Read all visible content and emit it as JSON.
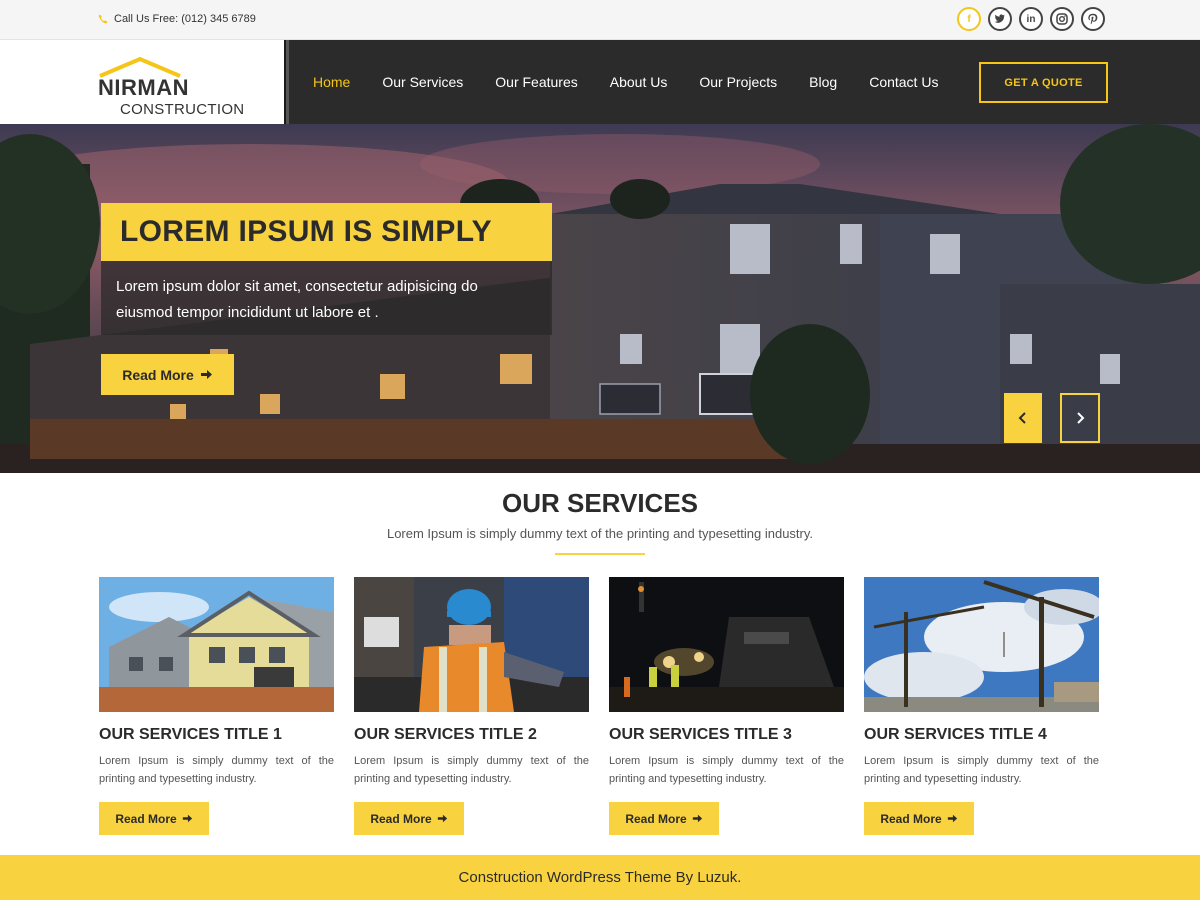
{
  "topbar": {
    "phone_text": "Call Us Free: (012) 345 6789",
    "socials": [
      "facebook-icon",
      "twitter-icon",
      "linkedin-icon",
      "instagram-icon",
      "pinterest-icon"
    ]
  },
  "logo": {
    "line1": "NIRMAN",
    "line2": "CONSTRUCTION"
  },
  "nav": {
    "items": [
      "Home",
      "Our Services",
      "Our Features",
      "About Us",
      "Our Projects",
      "Blog",
      "Contact Us"
    ],
    "active": "Home",
    "quote_label": "GET A QUOTE"
  },
  "hero": {
    "title": "LOREM IPSUM IS SIMPLY",
    "description": "Lorem ipsum dolor sit amet, consectetur adipisicing do eiusmod tempor incididunt ut labore et .",
    "button_label": "Read More"
  },
  "services": {
    "title": "OUR SERVICES",
    "subtitle": "Lorem Ipsum is simply dummy text of the printing and typesetting industry.",
    "cards": [
      {
        "title": "OUR SERVICES TITLE 1",
        "text": "Lorem Ipsum is simply dummy text of the printing and typesetting industry.",
        "button": "Read More"
      },
      {
        "title": "OUR SERVICES TITLE 2",
        "text": "Lorem Ipsum is simply dummy text of the printing and typesetting industry.",
        "button": "Read More"
      },
      {
        "title": "OUR SERVICES TITLE 3",
        "text": "Lorem Ipsum is simply dummy text of the printing and typesetting industry.",
        "button": "Read More"
      },
      {
        "title": "OUR SERVICES TITLE 4",
        "text": "Lorem Ipsum is simply dummy text of the printing and typesetting industry.",
        "button": "Read More"
      }
    ]
  },
  "footer": {
    "text": "Construction WordPress Theme By Luzuk."
  },
  "colors": {
    "accent": "#f9d33f",
    "dark": "#2b2b2b",
    "text": "#555555"
  }
}
